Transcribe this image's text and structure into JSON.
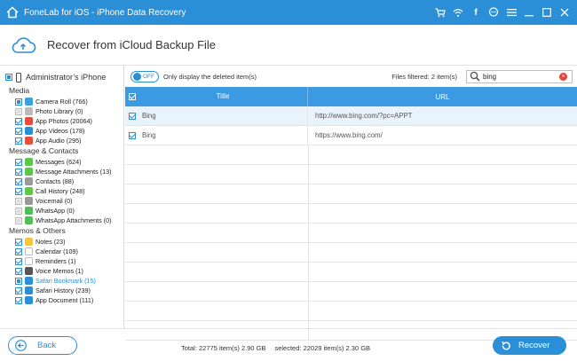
{
  "window": {
    "title": "FoneLab for iOS - iPhone Data Recovery"
  },
  "header": {
    "title": "Recover from iCloud Backup File"
  },
  "device": {
    "name": "Administrator’s iPhone"
  },
  "sidebar": {
    "sections": [
      {
        "title": "Media",
        "items": [
          {
            "label": "Camera Roll (766)",
            "icon": "camera-roll-icon",
            "color": "#3aa0e0",
            "state": "partial"
          },
          {
            "label": "Photo Library (0)",
            "icon": "photo-library-icon",
            "color": "#bbbbbb",
            "state": "disabled"
          },
          {
            "label": "App Photos (20064)",
            "icon": "app-photos-icon",
            "color": "#e74c3c",
            "state": "checked"
          },
          {
            "label": "App Videos (178)",
            "icon": "app-videos-icon",
            "color": "#2a8fd6",
            "state": "checked"
          },
          {
            "label": "App Audio (295)",
            "icon": "app-audio-icon",
            "color": "#e74c3c",
            "state": "checked"
          }
        ]
      },
      {
        "title": "Message & Contacts",
        "items": [
          {
            "label": "Messages (624)",
            "icon": "messages-icon",
            "color": "#5cc84a",
            "state": "checked"
          },
          {
            "label": "Message Attachments (13)",
            "icon": "message-attachments-icon",
            "color": "#5cc84a",
            "state": "checked"
          },
          {
            "label": "Contacts (88)",
            "icon": "contacts-icon",
            "color": "#9a9a9a",
            "state": "checked"
          },
          {
            "label": "Call History (248)",
            "icon": "call-history-icon",
            "color": "#5cc84a",
            "state": "checked"
          },
          {
            "label": "Voicemail (0)",
            "icon": "voicemail-icon",
            "color": "#9a9a9a",
            "state": "disabled"
          },
          {
            "label": "WhatsApp (0)",
            "icon": "whatsapp-icon",
            "color": "#4fbf5a",
            "state": "disabled"
          },
          {
            "label": "WhatsApp Attachments (0)",
            "icon": "whatsapp-attachments-icon",
            "color": "#4fbf5a",
            "state": "disabled"
          }
        ]
      },
      {
        "title": "Memos & Others",
        "items": [
          {
            "label": "Notes (23)",
            "icon": "notes-icon",
            "color": "#f5c542",
            "state": "checked"
          },
          {
            "label": "Calendar (109)",
            "icon": "calendar-icon",
            "color": "#ffffff",
            "state": "checked"
          },
          {
            "label": "Reminders (1)",
            "icon": "reminders-icon",
            "color": "#ffffff",
            "state": "checked"
          },
          {
            "label": "Voice Memos (1)",
            "icon": "voice-memos-icon",
            "color": "#555555",
            "state": "checked"
          },
          {
            "label": "Safari Bookmark (15)",
            "icon": "safari-bookmark-icon",
            "color": "#2a8fd6",
            "state": "partial",
            "active": true
          },
          {
            "label": "Safari History (239)",
            "icon": "safari-history-icon",
            "color": "#2a8fd6",
            "state": "checked"
          },
          {
            "label": "App Document (111)",
            "icon": "app-document-icon",
            "color": "#2a8fd6",
            "state": "checked"
          }
        ]
      }
    ]
  },
  "toolbar": {
    "toggle_label": "OFF",
    "only_deleted_label": "Only display the deleted item(s)",
    "files_filtered": "Files filtered: 2 item(s)",
    "search_value": "bing"
  },
  "table": {
    "columns": [
      "Title",
      "URL"
    ],
    "rows": [
      {
        "title": "Bing",
        "url": "http://www.bing.com/?pc=APPT",
        "selected": true
      },
      {
        "title": "Bing",
        "url": "https://www.bing.com/",
        "selected": false
      }
    ],
    "empty_rows": 10
  },
  "footer": {
    "back_label": "Back",
    "total": "Total: 22775 item(s) 2.90 GB",
    "selected": "selected: 22029 item(s) 2.30 GB",
    "recover_label": "Recover"
  },
  "colors": {
    "accent": "#2a8fd6",
    "header_bg": "#3b9ae1",
    "row_selected": "#e8f3fc",
    "clear_red": "#e2453c"
  }
}
